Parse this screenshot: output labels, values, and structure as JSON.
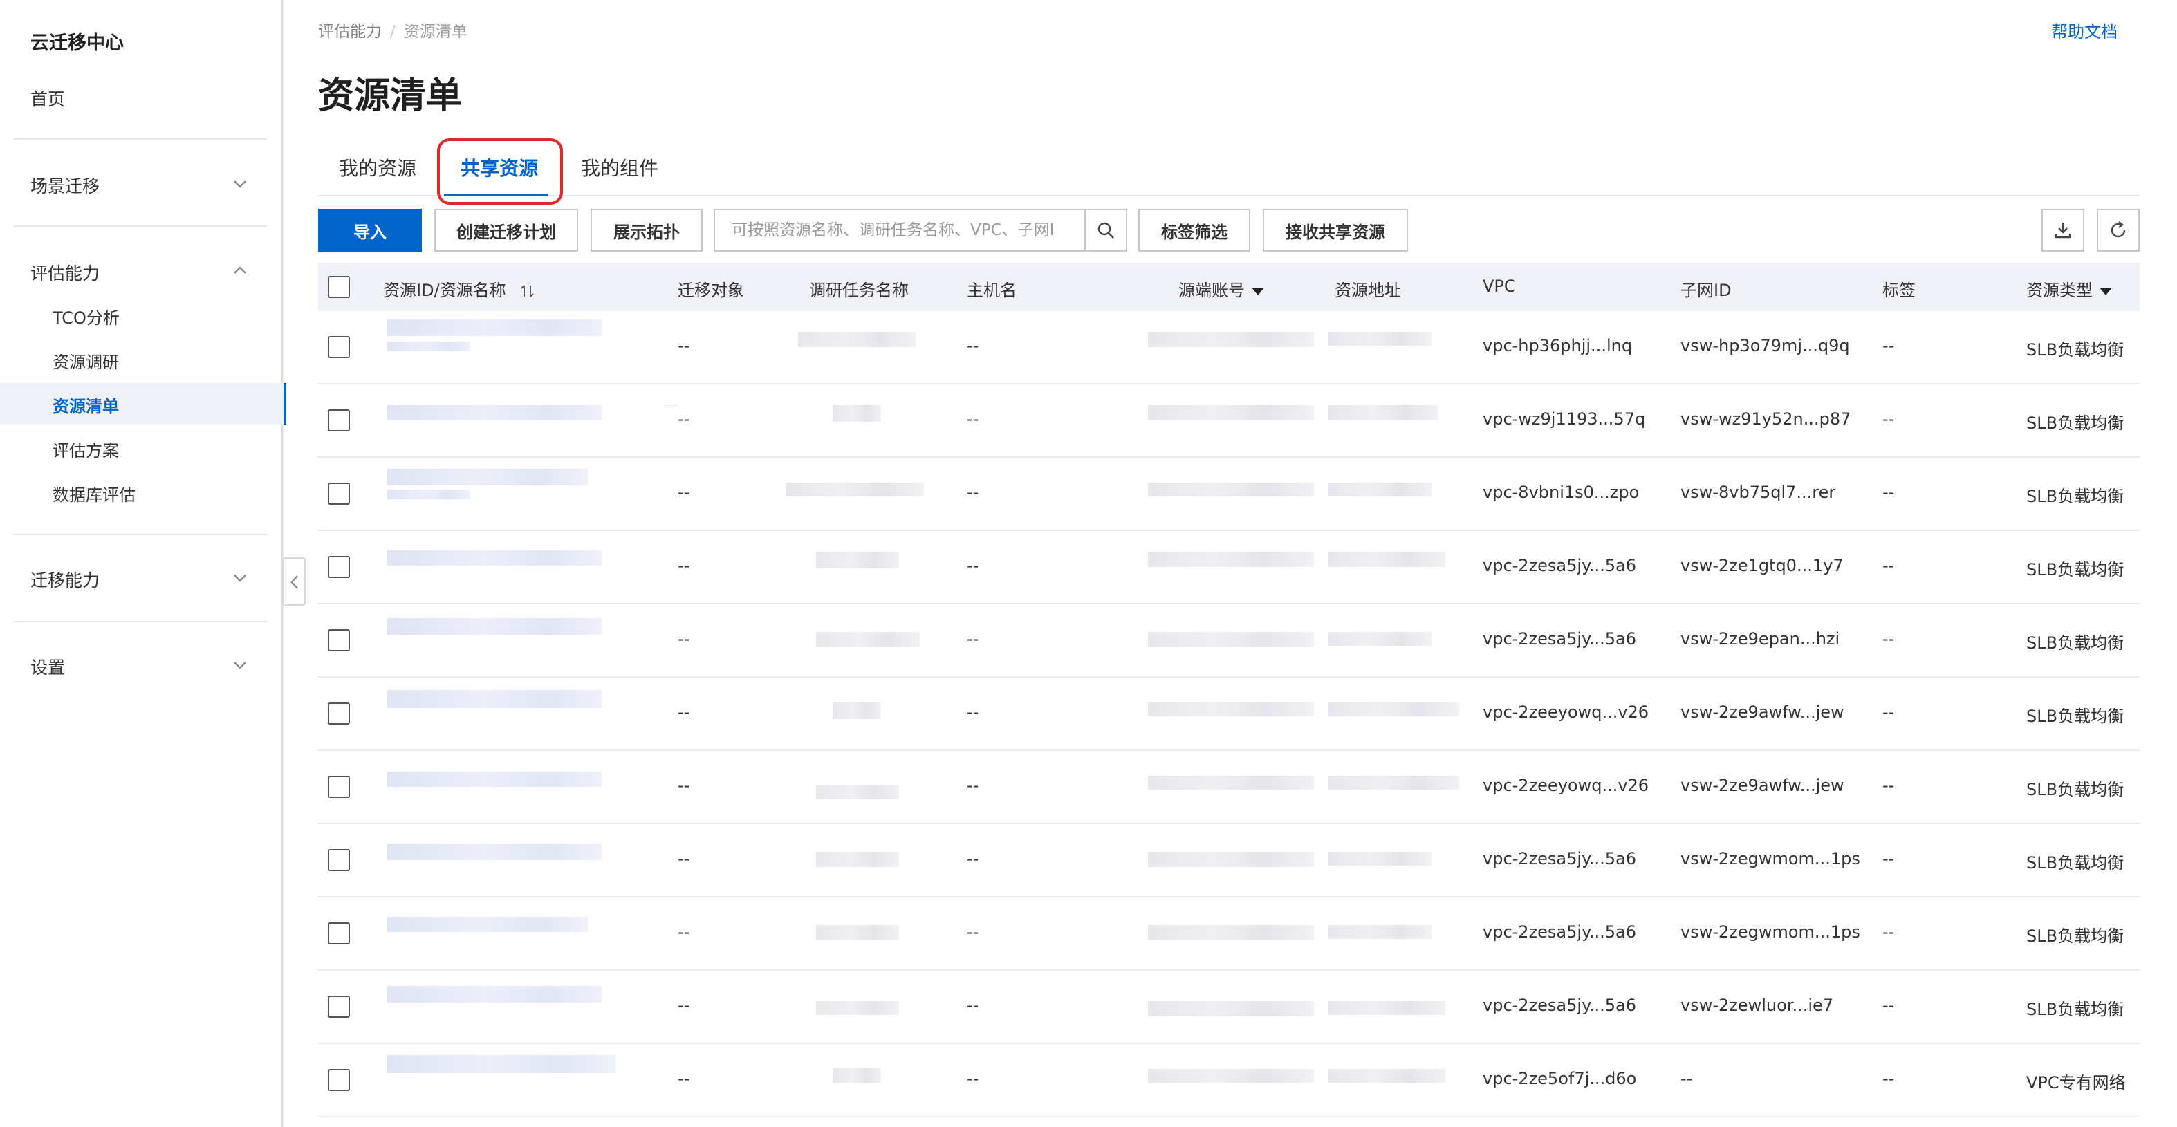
{
  "sidebar": {
    "title": "云迁移中心",
    "home": "首页",
    "groups": {
      "scene": "场景迁移",
      "assess": "评估能力",
      "migrate": "迁移能力",
      "settings": "设置"
    },
    "assess_items": [
      "TCO分析",
      "资源调研",
      "资源清单",
      "评估方案",
      "数据库评估"
    ],
    "active_item": "资源清单"
  },
  "breadcrumb": {
    "parent": "评估能力",
    "separator": "/",
    "current": "资源清单"
  },
  "help_link": "帮助文档",
  "page_title": "资源清单",
  "tabs": [
    "我的资源",
    "共享资源",
    "我的组件"
  ],
  "active_tab": "共享资源",
  "toolbar": {
    "import": "导入",
    "create_plan": "创建迁移计划",
    "topology": "展示拓扑",
    "search_placeholder": "可按照资源名称、调研任务名称、VPC、子网I",
    "tag_filter": "标签筛选",
    "accept_shared": "接收共享资源"
  },
  "table": {
    "headers": {
      "resource": "资源ID/资源名称",
      "target": "迁移对象",
      "task": "调研任务名称",
      "host": "主机名",
      "account": "源端账号",
      "address": "资源地址",
      "vpc": "VPC",
      "subnet": "子网ID",
      "tag": "标签",
      "type": "资源类型"
    },
    "rows": [
      {
        "target": "--",
        "host": "--",
        "vpc": "vpc-hp36phjj...lnq",
        "subnet": "vsw-hp3o79mj...q9q",
        "tag": "--",
        "type": "SLB负载均衡"
      },
      {
        "target": "--",
        "host": "--",
        "vpc": "vpc-wz9j1193...57q",
        "subnet": "vsw-wz91y52n...p87",
        "tag": "--",
        "type": "SLB负载均衡"
      },
      {
        "target": "--",
        "host": "--",
        "vpc": "vpc-8vbni1s0...zpo",
        "subnet": "vsw-8vb75ql7...rer",
        "tag": "--",
        "type": "SLB负载均衡"
      },
      {
        "target": "--",
        "host": "--",
        "vpc": "vpc-2zesa5jy...5a6",
        "subnet": "vsw-2ze1gtq0...1y7",
        "tag": "--",
        "type": "SLB负载均衡"
      },
      {
        "target": "--",
        "host": "--",
        "vpc": "vpc-2zesa5jy...5a6",
        "subnet": "vsw-2ze9epan...hzi",
        "tag": "--",
        "type": "SLB负载均衡"
      },
      {
        "target": "--",
        "host": "--",
        "vpc": "vpc-2zeeyowq...v26",
        "subnet": "vsw-2ze9awfw...jew",
        "tag": "--",
        "type": "SLB负载均衡"
      },
      {
        "target": "--",
        "host": "--",
        "vpc": "vpc-2zeeyowq...v26",
        "subnet": "vsw-2ze9awfw...jew",
        "tag": "--",
        "type": "SLB负载均衡"
      },
      {
        "target": "--",
        "host": "--",
        "vpc": "vpc-2zesa5jy...5a6",
        "subnet": "vsw-2zegwmom...1ps",
        "tag": "--",
        "type": "SLB负载均衡"
      },
      {
        "target": "--",
        "host": "--",
        "vpc": "vpc-2zesa5jy...5a6",
        "subnet": "vsw-2zegwmom...1ps",
        "tag": "--",
        "type": "SLB负载均衡"
      },
      {
        "target": "--",
        "host": "--",
        "vpc": "vpc-2zesa5jy...5a6",
        "subnet": "vsw-2zewluor...ie7",
        "tag": "--",
        "type": "SLB负载均衡"
      },
      {
        "target": "--",
        "host": "--",
        "vpc": "vpc-2ze5of7j...d6o",
        "subnet": "--",
        "tag": "--",
        "type": "VPC专有网络"
      }
    ]
  },
  "colors": {
    "accent": "#0064c8",
    "highlight": "#e0292b",
    "header_bg": "#eff1f6"
  },
  "icons": [
    "chevron-down-icon",
    "chevron-up-icon",
    "chevron-left-icon",
    "search-icon",
    "download-icon",
    "refresh-icon",
    "sort-icon",
    "caret-down-icon"
  ]
}
